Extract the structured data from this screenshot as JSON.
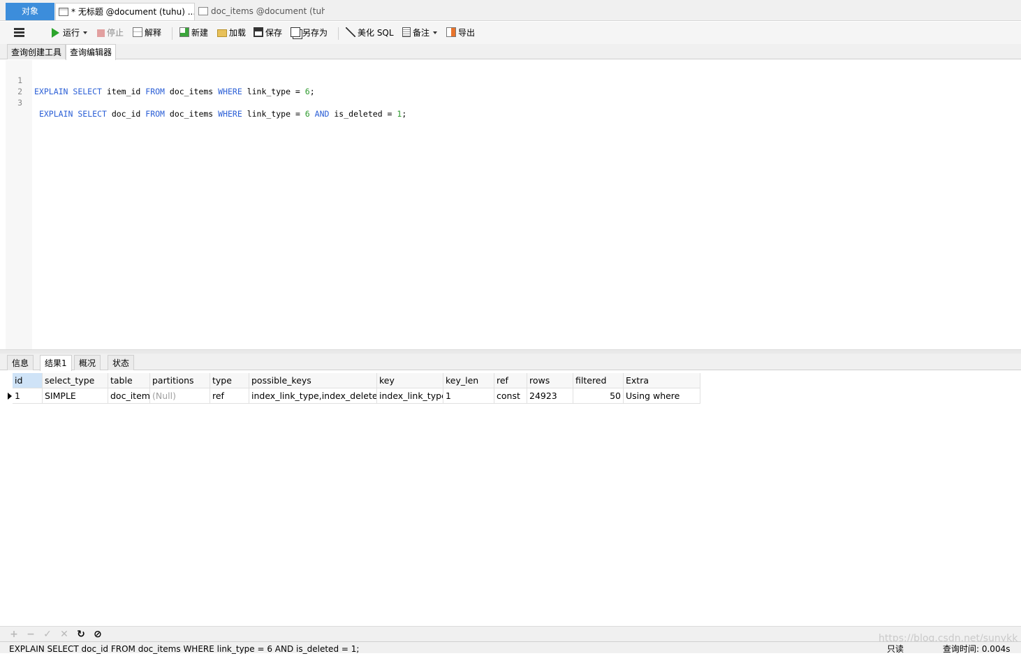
{
  "tabs": {
    "objects": "对象",
    "query": "* 无标题 @document (tuhu) ...",
    "doc_items": "doc_items @document (tuh..."
  },
  "toolbar": {
    "run": "运行",
    "stop": "停止",
    "explain": "解释",
    "new": "新建",
    "load": "加载",
    "save": "保存",
    "save_as": "另存为",
    "beautify": "美化 SQL",
    "notes": "备注",
    "export": "导出"
  },
  "subtabs": {
    "builder": "查询创建工具",
    "editor": "查询编辑器"
  },
  "editor": {
    "line_numbers": [
      "1",
      "2",
      "3"
    ]
  },
  "result_tabs": [
    "信息",
    "结果1",
    "概况",
    "状态"
  ],
  "grid": {
    "columns": [
      "id",
      "select_type",
      "table",
      "partitions",
      "type",
      "possible_keys",
      "key",
      "key_len",
      "ref",
      "rows",
      "filtered",
      "Extra"
    ],
    "rows": [
      [
        "1",
        "SIMPLE",
        "doc_items",
        "(Null)",
        "ref",
        "index_link_type,index_deleted",
        "index_link_type",
        "1",
        "const",
        "24923",
        "50",
        "Using where"
      ]
    ]
  },
  "bottombar": {
    "add": "+",
    "remove": "−",
    "apply": "✓",
    "cancel": "✕",
    "refresh": "↻",
    "stop": "⊘"
  },
  "status": {
    "sql": "EXPLAIN SELECT doc_id FROM doc_items WHERE link_type = 6 AND is_deleted = 1;",
    "mode": "只读",
    "query_time": "查询时间: 0.004s"
  },
  "watermark": "https://blog.csdn.net/sunykk"
}
